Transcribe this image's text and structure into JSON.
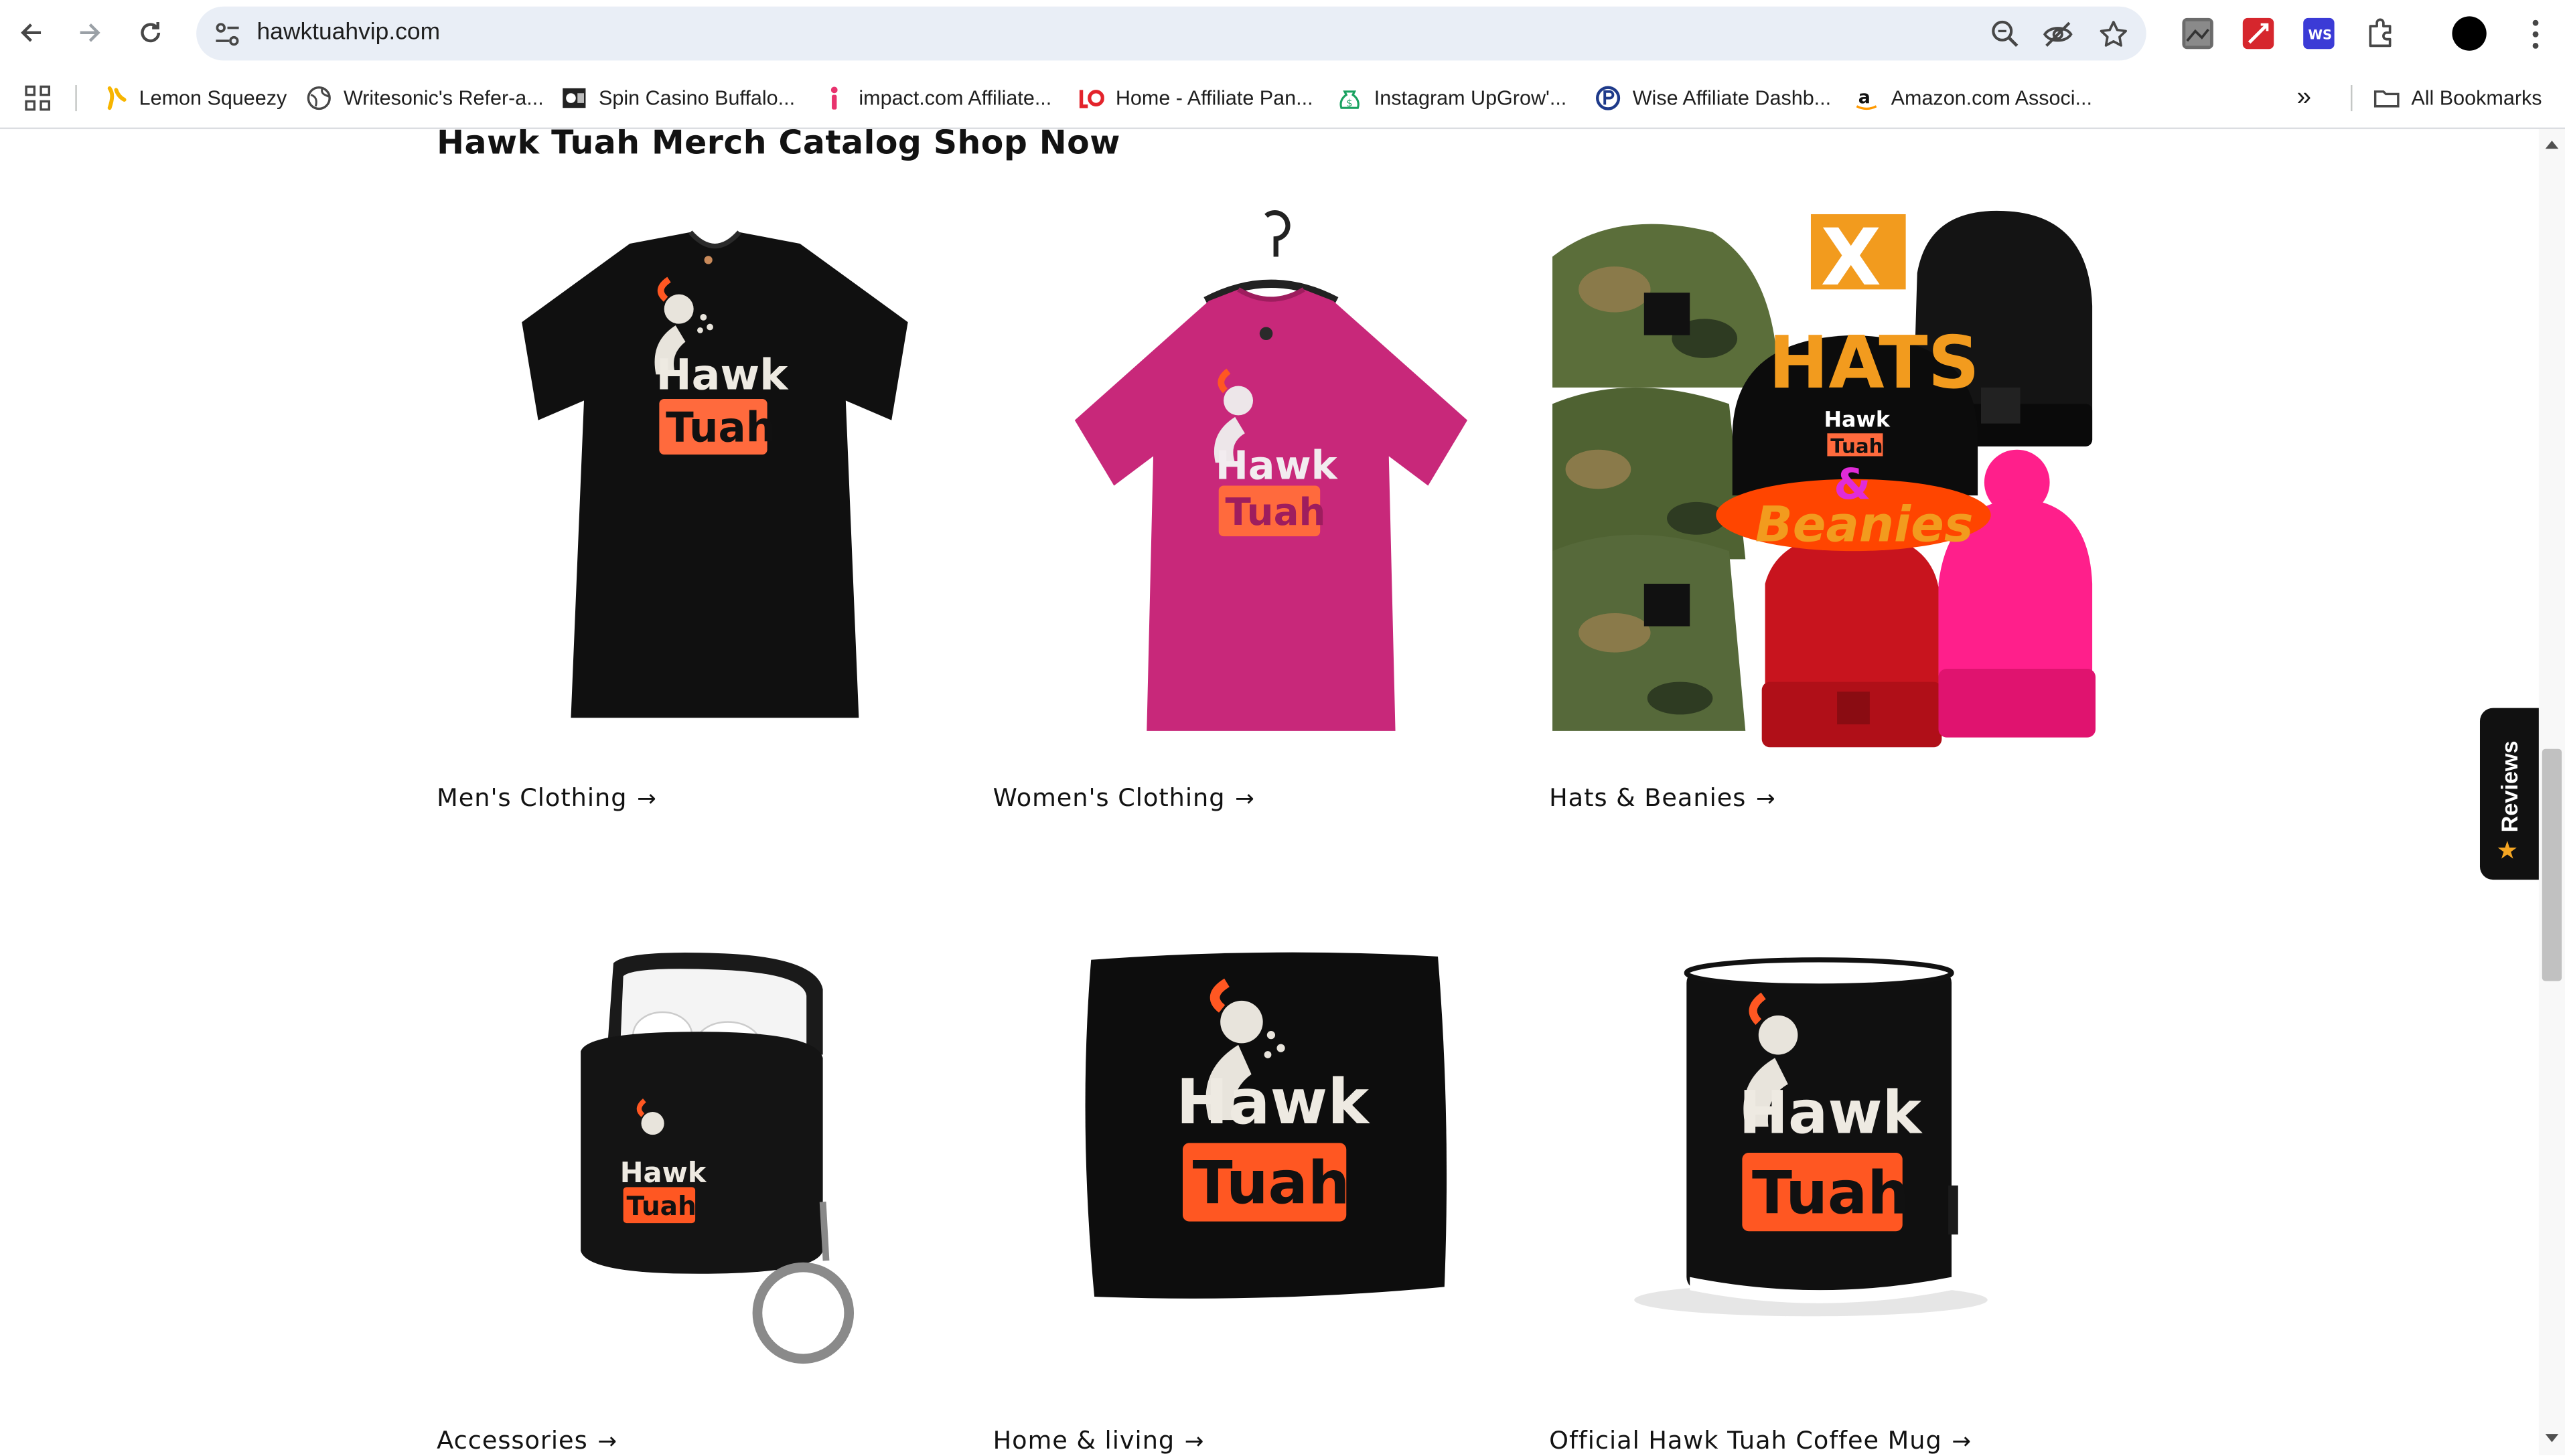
{
  "browser": {
    "url": "hawktuahvip.com",
    "bookmarks": [
      {
        "label": "Lemon Squeezy"
      },
      {
        "label": "Writesonic's Refer-a..."
      },
      {
        "label": "Spin Casino Buffalo..."
      },
      {
        "label": "impact.com Affiliate..."
      },
      {
        "label": "Home - Affiliate Pan..."
      },
      {
        "label": "Instagram UpGrow'..."
      },
      {
        "label": "Wise Affiliate Dashb..."
      },
      {
        "label": "Amazon.com Associ..."
      }
    ],
    "more_chevron": "»",
    "all_bookmarks": "All Bookmarks"
  },
  "page": {
    "catalog_title": "Hawk Tuah Merch Catalog Shop Now",
    "products": [
      {
        "label": "Men's Clothing"
      },
      {
        "label": "Women's Clothing"
      },
      {
        "label": "Hats & Beanies"
      },
      {
        "label": "Accessories"
      },
      {
        "label": "Home & living"
      },
      {
        "label": "Official Hawk Tuah Coffee Mug"
      }
    ],
    "arrow": "→",
    "logo_text": {
      "line1": "Hawk",
      "line2": "Tuah"
    },
    "hats_promo": {
      "x": "X",
      "line1": "HATS",
      "amp": "&",
      "line2": "Beanies"
    }
  },
  "reviews_tab": {
    "label": "Reviews",
    "star": "★"
  },
  "colors": {
    "logo_orange": "#ff5722",
    "brand_black": "#111111",
    "pink_tee": "#c8287a",
    "hot_pink": "#ff1f8b",
    "red_beanie": "#c8141e",
    "promo_orange": "#f29b1e"
  }
}
